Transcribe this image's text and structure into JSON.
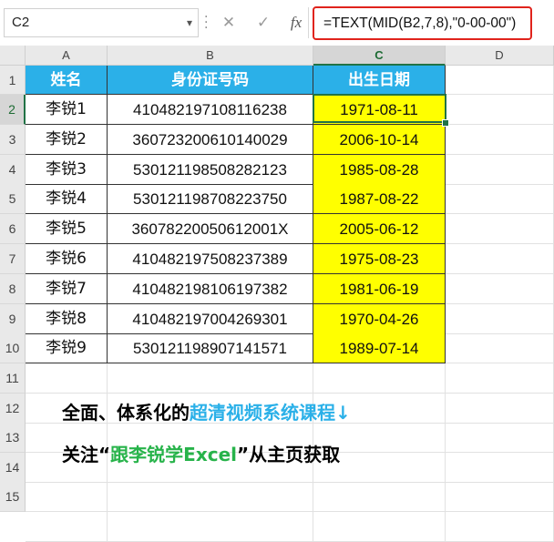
{
  "formula_bar": {
    "name_box": "C2",
    "cancel_glyph": "✕",
    "enter_glyph": "✓",
    "fx_glyph": "fx",
    "formula": "=TEXT(MID(B2,7,8),\"0-00-00\")"
  },
  "columns": [
    "A",
    "B",
    "C",
    "D"
  ],
  "rows": [
    "1",
    "2",
    "3",
    "4",
    "5",
    "6",
    "7",
    "8",
    "9",
    "10",
    "11",
    "12",
    "13",
    "14",
    "15"
  ],
  "table": {
    "headers": [
      "姓名",
      "身份证号码",
      "出生日期"
    ],
    "records": [
      {
        "name": "李锐1",
        "id": "410482197108116238",
        "birth": "1971-08-11"
      },
      {
        "name": "李锐2",
        "id": "360723200610140029",
        "birth": "2006-10-14"
      },
      {
        "name": "李锐3",
        "id": "530121198508282123",
        "birth": "1985-08-28"
      },
      {
        "name": "李锐4",
        "id": "530121198708223750",
        "birth": "1987-08-22"
      },
      {
        "name": "李锐5",
        "id": "36078220050612001X",
        "birth": "2005-06-12"
      },
      {
        "name": "李锐6",
        "id": "410482197508237389",
        "birth": "1975-08-23"
      },
      {
        "name": "李锐7",
        "id": "410482198106197382",
        "birth": "1981-06-19"
      },
      {
        "name": "李锐8",
        "id": "410482197004269301",
        "birth": "1970-04-26"
      },
      {
        "name": "李锐9",
        "id": "530121198907141571",
        "birth": "1989-07-14"
      }
    ]
  },
  "promo": {
    "line1_black": "全面、体系化的",
    "line1_blue": "超清视频系统课程↓",
    "line2_black_a": "关注“",
    "line2_green": "跟李锐学Excel",
    "line2_black_b": "”从主页获取"
  },
  "colors": {
    "header_fill": "#2bb0e8",
    "result_fill": "#ffff00",
    "selection": "#217346",
    "formula_highlight": "#e0231c"
  }
}
